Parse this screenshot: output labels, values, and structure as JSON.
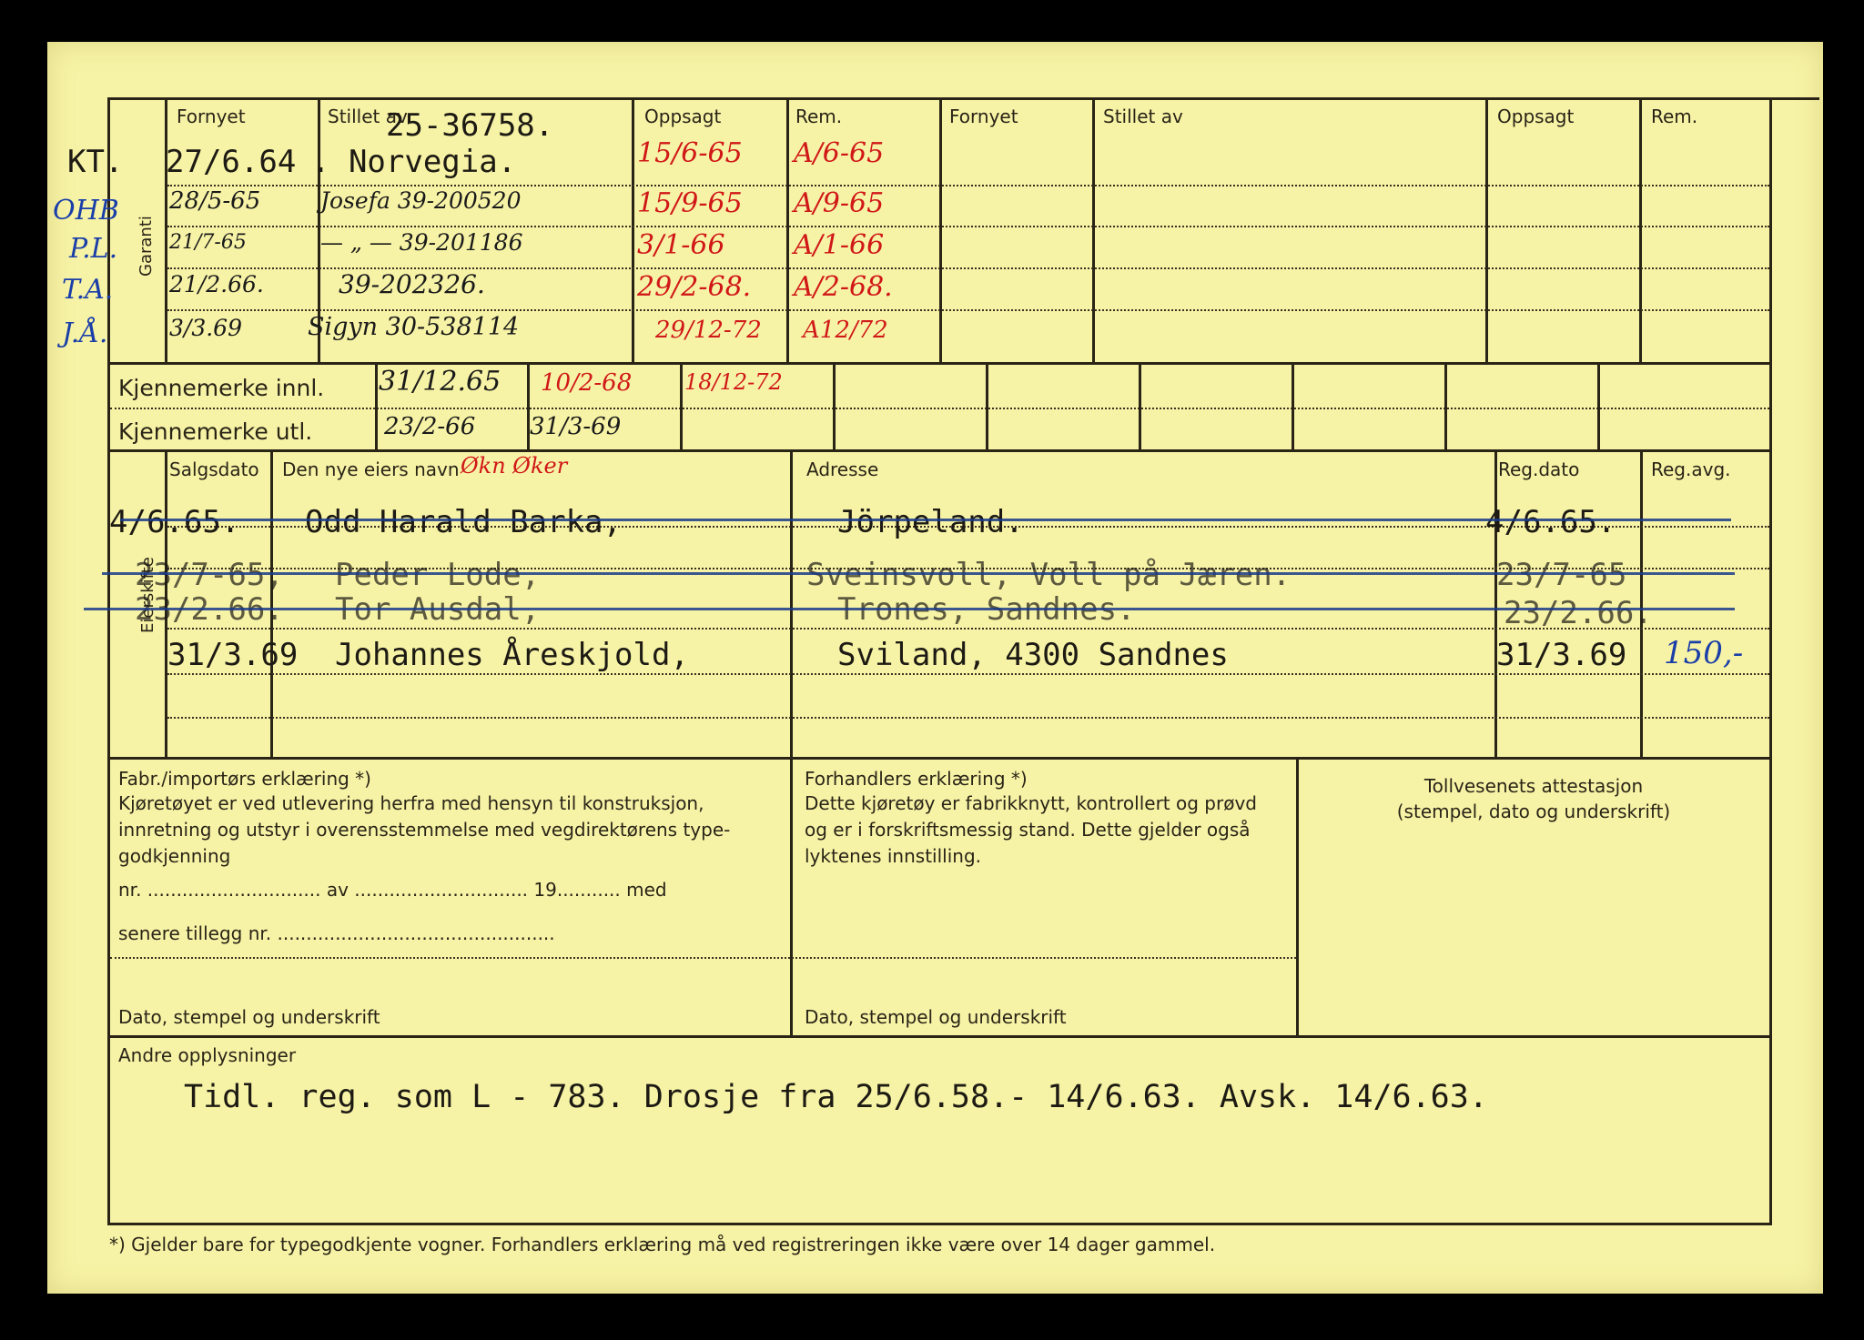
{
  "header": {
    "fornyet_1": "Fornyet",
    "stillet_av_1": "Stillet av",
    "oppsagt_1": "Oppsagt",
    "rem_1": "Rem.",
    "fornyet_2": "Fornyet",
    "stillet_av_2": "Stillet av",
    "oppsagt_2": "Oppsagt",
    "rem_2": "Rem.",
    "garanti": "Garanti"
  },
  "guarantee": {
    "policy_no": "25-36758.",
    "kt": "KT.",
    "fornyet_first": "27/6.64",
    "company": ". Norvegia.",
    "left_notes": [
      "OHB",
      "P.L.",
      "T.A.",
      "J.Å."
    ],
    "rows": [
      {
        "fornyet": "",
        "stillet_av": "",
        "oppsagt": "15/6-65",
        "rem": "A/6-65"
      },
      {
        "fornyet": "28/5-65",
        "stillet_av": "Josefa 39-200520",
        "oppsagt": "15/9-65",
        "rem": "A/9-65"
      },
      {
        "fornyet": "21/7-65",
        "stillet_av": "— „ — 39-201186",
        "oppsagt": "3/1-66",
        "rem": "A/1-66"
      },
      {
        "fornyet": "21/2.66.",
        "stillet_av": "39-202326.",
        "oppsagt": "29/2-68.",
        "rem": "A/2-68."
      },
      {
        "fornyet": "3/3.69",
        "stillet_av": "Sigyn 30-538114",
        "oppsagt": "29/12-72",
        "rem": "A12/72"
      }
    ]
  },
  "kjennemerke": {
    "innl_label": "Kjennemerke innl.",
    "utl_label": "Kjennemerke utl.",
    "innl_values": [
      "31/12.65",
      "10/2-68",
      "18/12-72"
    ],
    "utl_values": [
      "23/2-66",
      "31/3-69"
    ]
  },
  "eierskifte": {
    "label": "Eierskifte",
    "col_salgsdato": "Salgsdato",
    "col_navn": "Den nye eiers navn",
    "col_adresse": "Adresse",
    "col_regdato": "Reg.dato",
    "col_regavg": "Reg.avg.",
    "hand_notes": "Økn   Øker",
    "rows": [
      {
        "salgsdato": "4/6.65.",
        "navn": "Odd Harald Barka,",
        "adresse": "Jörpeland.",
        "regdato": "4/6.65.",
        "regavg": ""
      },
      {
        "salgsdato": "23/7-65,",
        "navn": "Peder Lode,",
        "adresse": "Sveinsvoll, Voll på Jæren.",
        "regdato": "23/7-65",
        "regavg": ""
      },
      {
        "salgsdato": "23/2.66.",
        "navn": "Tor Ausdal,",
        "adresse": "Trones, Sandnes.",
        "regdato": "23/2.66.",
        "regavg": ""
      },
      {
        "salgsdato": "31/3.69",
        "navn": "Johannes Åreskjold,",
        "adresse": "Sviland, 4300 Sandnes",
        "regdato": "31/3.69",
        "regavg": "150,-"
      }
    ]
  },
  "declarations": {
    "fabr_title": "Fabr./importørs erklæring *)",
    "fabr_body": "Kjøretøyet er ved utlevering herfra med hensyn til konstruksjon, innretning og utstyr i overensstemmelse med vegdirektørens type-godkjenning",
    "fabr_nr_line": "nr. .............................. av .............................. 19........... med",
    "fabr_tillegg_line": "senere tillegg nr. ................................................",
    "fabr_footer": "Dato, stempel og underskrift",
    "forh_title": "Forhandlers erklæring *)",
    "forh_body": "Dette kjøretøy er fabrikknytt, kontrollert og prøvd og er i forskriftsmessig stand. Dette gjelder også lyktenes innstilling.",
    "forh_footer": "Dato, stempel og underskrift",
    "toll_title": "Tollvesenets attestasjon",
    "toll_sub": "(stempel, dato og underskrift)"
  },
  "andre": {
    "label": "Andre opplysninger",
    "text": "Tidl. reg. som L - 783. Drosje fra 25/6.58.- 14/6.63. Avsk. 14/6.63."
  },
  "footnote": "*)  Gjelder bare for typegodkjente vogner.  Forhandlers erklæring må ved registreringen ikke være over 14 dager gammel."
}
